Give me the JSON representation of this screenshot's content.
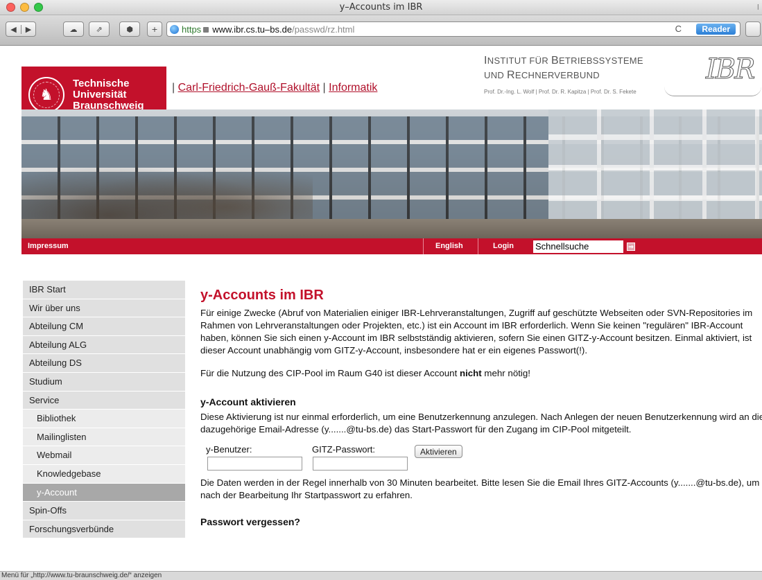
{
  "window": {
    "title": "y–Accounts im IBR",
    "title_right": "I"
  },
  "toolbar": {
    "url_scheme": "https",
    "url_host": "www.ibr.cs.tu–bs.de",
    "url_path": "/passwd/rz.html",
    "reload_symbol": "C",
    "reader_label": "Reader"
  },
  "header": {
    "tu_logo": [
      "Technische",
      "Universität",
      "Braunschweig"
    ],
    "faculty_separator_1": "|",
    "faculty_link": "Carl-Friedrich-Gauß-Fakultät",
    "faculty_separator_2": "|",
    "informatik_link": "Informatik",
    "institute_line1_a": "I",
    "institute_line1_b": "NSTITUT FÜR ",
    "institute_line1_c": "B",
    "institute_line1_d": "ETRIEBSSYSTEME",
    "institute_line2_a": "UND ",
    "institute_line2_b": "R",
    "institute_line2_c": "ECHNERVERBUND",
    "professors": "Prof. Dr.-Ing. L. Wolf | Prof. Dr. R. Kapitza | Prof. Dr. S. Fekete",
    "ibr_logo": "IBR"
  },
  "redbar": {
    "impressum": "Impressum",
    "english": "English",
    "login": "Login",
    "search_value": "Schnellsuche",
    "go_symbol": "⇒"
  },
  "sidebar": {
    "items": [
      {
        "label": "IBR Start"
      },
      {
        "label": "Wir über uns"
      },
      {
        "label": "Abteilung CM"
      },
      {
        "label": "Abteilung ALG"
      },
      {
        "label": "Abteilung DS"
      },
      {
        "label": "Studium"
      },
      {
        "label": "Service"
      },
      {
        "label": "Bibliothek"
      },
      {
        "label": "Mailinglisten"
      },
      {
        "label": "Webmail"
      },
      {
        "label": "Knowledgebase"
      },
      {
        "label": "y-Account"
      },
      {
        "label": "Spin-Offs"
      },
      {
        "label": "Forschungsverbünde"
      }
    ]
  },
  "content": {
    "title": "y-Accounts im IBR",
    "intro": "Für einige Zwecke (Abruf von Materialien einiger IBR-Lehrveranstaltungen, Zugriff auf geschützte Webseiten oder SVN-Repositories im Rahmen von Lehrveranstaltungen oder Projekten, etc.) ist ein Account im IBR erforderlich. Wenn Sie keinen \"regulären\" IBR-Account haben, können Sie sich einen y-Account im IBR selbstständig aktivieren, sofern Sie einen GITZ-y-Account besitzen. Einmal aktiviert, ist dieser Account unabhängig vom GITZ-y-Account, insbesondere hat er ein eigenes Passwort(!).",
    "cip_before": "Für die Nutzung des CIP-Pool im Raum G40 ist dieser Account ",
    "cip_bold": "nicht",
    "cip_after": " mehr nötig!",
    "activate_heading": "y-Account aktivieren",
    "activate_text": "Diese Aktivierung ist nur einmal erforderlich, um eine Benutzerkennung anzulegen. Nach Anlegen der neuen Benutzerkennung wird an die dazugehörige Email-Adresse (y.......@tu-bs.de) das Start-Passwort für den Zugang im CIP-Pool mitgeteilt.",
    "user_label": "y-Benutzer:",
    "password_label": "GITZ-Passwort:",
    "activate_button": "Aktivieren",
    "processing_text": "Die Daten werden in der Regel innerhalb von 30 Minuten bearbeitet. Bitte lesen Sie die Email Ihres GITZ-Accounts (y.......@tu-bs.de), um nach der Bearbeitung Ihr Startpasswort zu erfahren.",
    "forgot_heading": "Passwort vergessen?"
  },
  "statusbar": {
    "text": "Menü für „http://www.tu-braunschweig.de/“ anzeigen"
  }
}
